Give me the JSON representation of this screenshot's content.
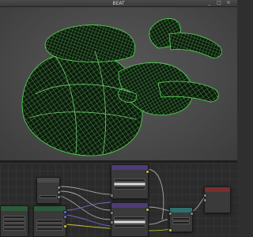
{
  "window": {
    "title": "BEAT",
    "controls": [
      "_",
      "□",
      "×"
    ]
  },
  "viewport": {
    "object": "heart-wireframe-model",
    "wire_color": "#6fe36f",
    "background": "#4a4a4a"
  },
  "node_editor": {
    "nodes": [
      {
        "id": "group-input",
        "title": "",
        "header_color": "#5a5a5a"
      },
      {
        "id": "texture-coordinate",
        "title": "",
        "header_color": "#7a2d2d"
      },
      {
        "id": "mix-node",
        "title": "",
        "header_color": "#5a5a5a"
      },
      {
        "id": "image-texture-top",
        "title": "",
        "header_color": "#6b4f9e"
      },
      {
        "id": "image-texture-bottom",
        "title": "",
        "header_color": "#6b4f9e"
      },
      {
        "id": "math-node",
        "title": "",
        "header_color": "#2f6f6f"
      },
      {
        "id": "group-output",
        "title": "",
        "header_color": "#7a2d2d"
      }
    ]
  }
}
